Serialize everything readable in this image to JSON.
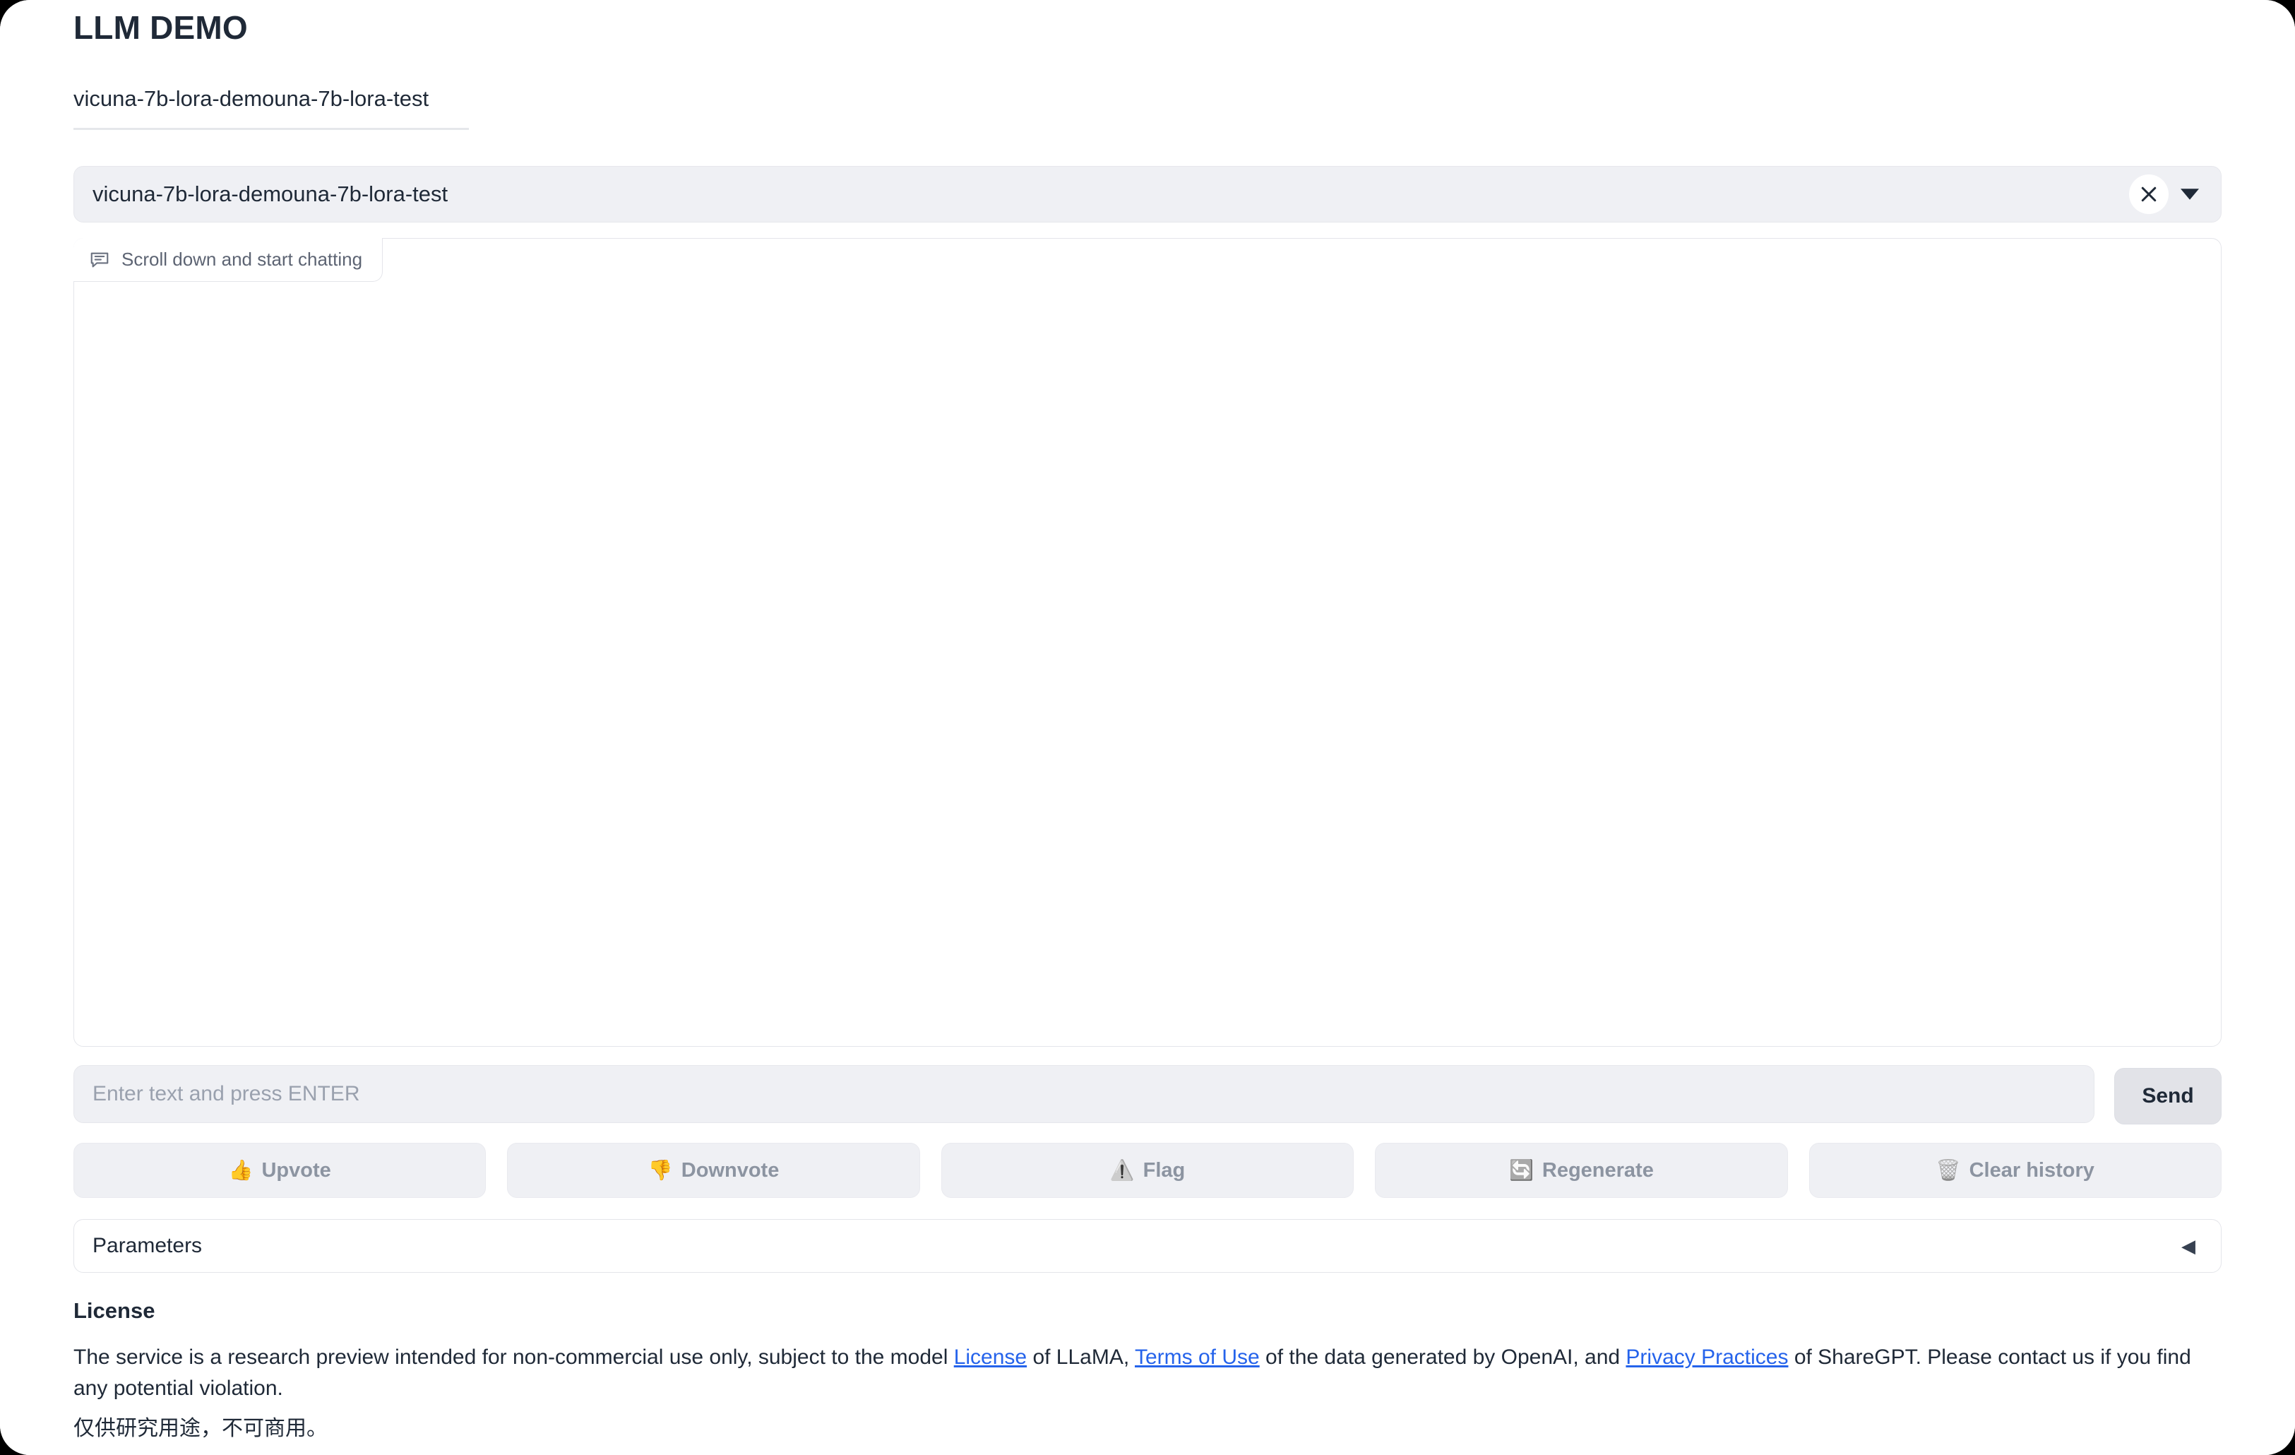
{
  "window": {
    "background_color": "#000000",
    "page_color": "#ffffff"
  },
  "header": {
    "title": "LLM DEMO"
  },
  "model_name_box": {
    "value": "vicuna-7b-lora-demouna-7b-lora-test"
  },
  "model_dropdown": {
    "selected": "vicuna-7b-lora-demouna-7b-lora-test",
    "clear_icon": "close-icon",
    "caret_icon": "chevron-down-icon"
  },
  "chatbot": {
    "label": "Scroll down and start chatting",
    "label_icon": "chat-bubble-icon",
    "messages": []
  },
  "message_input": {
    "value": "",
    "placeholder": "Enter text and press ENTER"
  },
  "send_button": {
    "label": "Send"
  },
  "action_buttons": [
    {
      "label": "Upvote",
      "emoji": "👍",
      "icon": "thumbs-up-icon",
      "name": "upvote-button",
      "gray": false
    },
    {
      "label": "Downvote",
      "emoji": "👎",
      "icon": "thumbs-down-icon",
      "name": "downvote-button",
      "gray": false
    },
    {
      "label": "Flag",
      "emoji": "⚠️",
      "icon": "warning-icon",
      "name": "flag-button",
      "gray": true
    },
    {
      "label": "Regenerate",
      "emoji": "🔄",
      "icon": "refresh-icon",
      "name": "regenerate-button",
      "gray": true
    },
    {
      "label": "Clear history",
      "emoji": "🗑️",
      "icon": "trash-icon",
      "name": "clear-history-button",
      "gray": true
    }
  ],
  "parameters_accordion": {
    "title": "Parameters",
    "expanded": false,
    "arrow_glyph": "◀",
    "arrow_icon": "triangle-left-icon"
  },
  "license": {
    "heading": "License",
    "text_part_1": "The service is a research preview intended for non-commercial use only, subject to the model ",
    "link_license": "License",
    "text_part_2": " of LLaMA, ",
    "link_terms": "Terms of Use",
    "text_part_3": " of the data generated by OpenAI, and ",
    "link_privacy": "Privacy Practices",
    "text_part_4": " of ShareGPT. Please contact us if you find any potential violation.",
    "chinese_note": "仅供研究用途，不可商用。",
    "link_color": "#2563eb"
  }
}
